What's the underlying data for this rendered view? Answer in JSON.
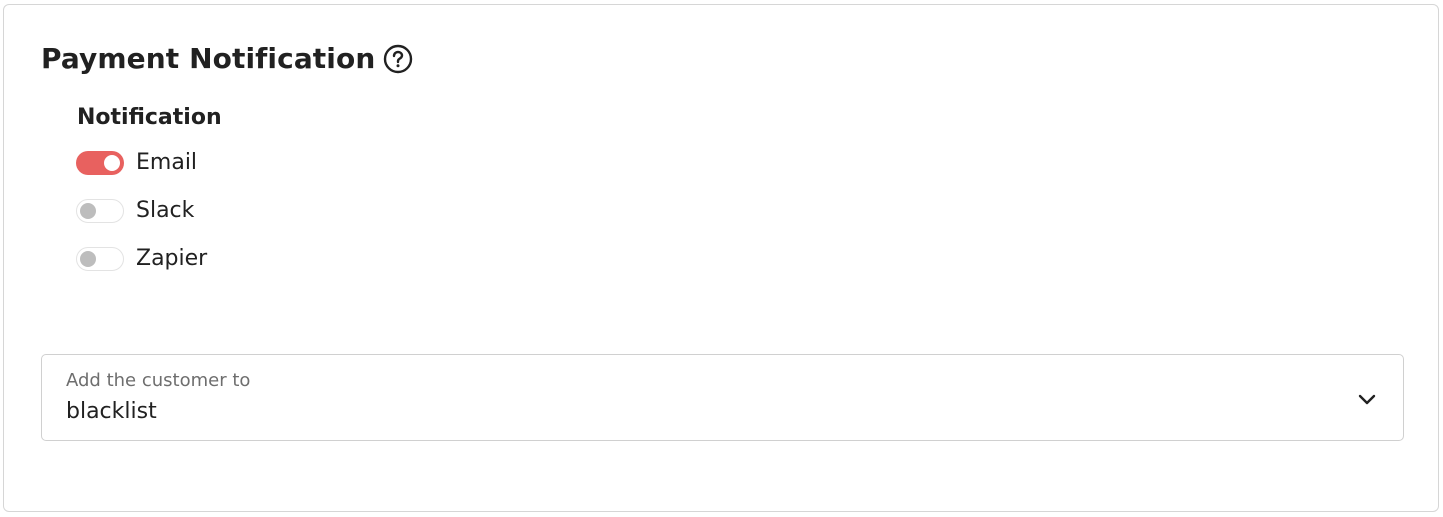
{
  "header": {
    "title": "Payment Notification",
    "help_icon": "question-circle-icon"
  },
  "notification": {
    "label": "Notification",
    "channels": [
      {
        "label": "Email",
        "enabled": true
      },
      {
        "label": "Slack",
        "enabled": false
      },
      {
        "label": "Zapier",
        "enabled": false
      }
    ]
  },
  "customer_select": {
    "caption": "Add the customer to",
    "value": "blacklist",
    "icon": "chevron-down-icon"
  },
  "colors": {
    "accent": "#e8615f",
    "toggle_off_knob": "#bdbdbd",
    "border": "#d0d0d0"
  }
}
